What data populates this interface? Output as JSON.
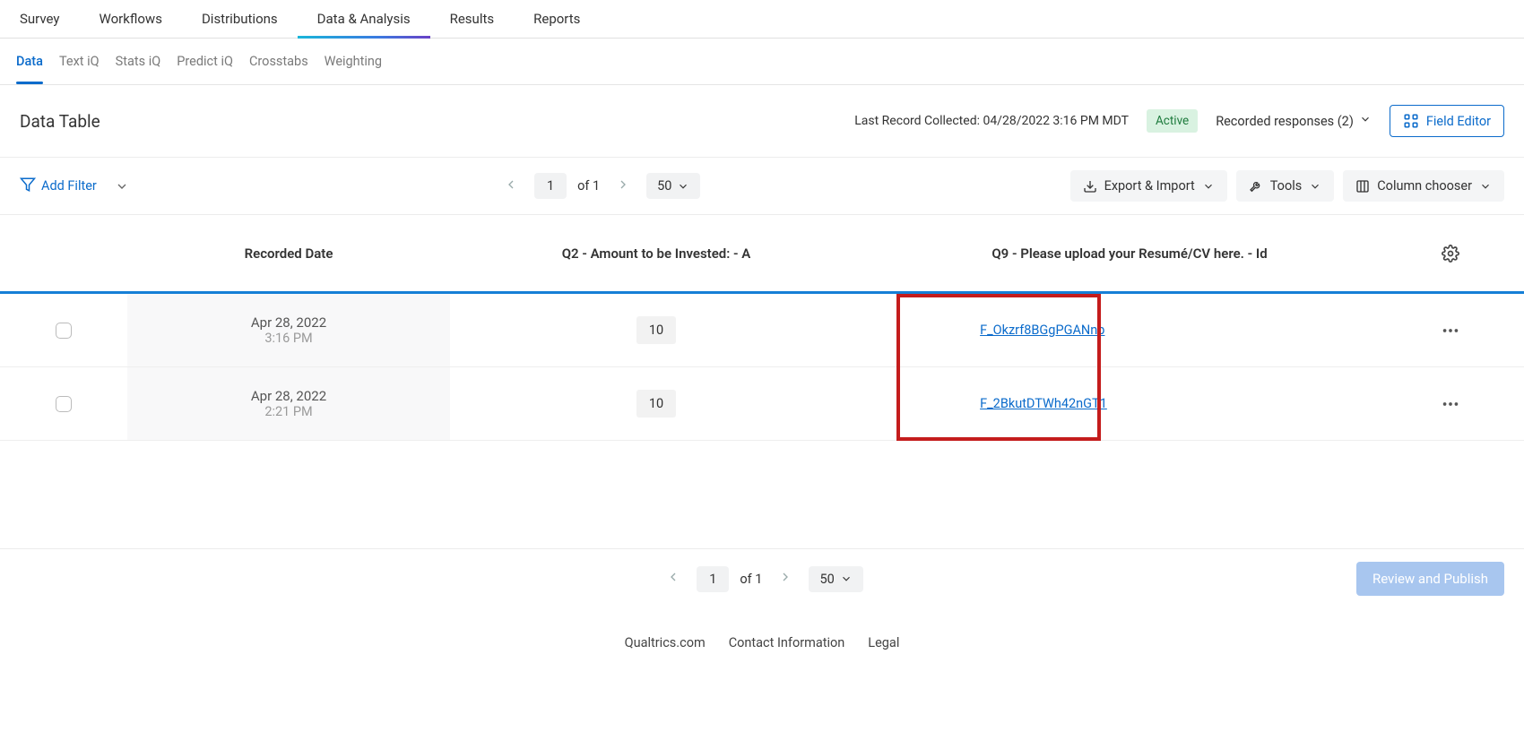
{
  "topnav": {
    "items": [
      "Survey",
      "Workflows",
      "Distributions",
      "Data & Analysis",
      "Results",
      "Reports"
    ],
    "activeIndex": 3
  },
  "subnav": {
    "items": [
      "Data",
      "Text iQ",
      "Stats iQ",
      "Predict iQ",
      "Crosstabs",
      "Weighting"
    ],
    "activeIndex": 0
  },
  "header": {
    "title": "Data Table",
    "lastRecord": "Last Record Collected: 04/28/2022 3:16 PM MDT",
    "status": "Active",
    "responses": "Recorded responses (2)",
    "fieldEditor": "Field Editor"
  },
  "toolbar": {
    "addFilter": "Add Filter",
    "page": "1",
    "ofPages": "of 1",
    "pageSize": "50",
    "exportImport": "Export & Import",
    "tools": "Tools",
    "columnChooser": "Column chooser"
  },
  "table": {
    "columns": {
      "recordedDate": "Recorded Date",
      "q2": "Q2 - Amount to be Invested: - A",
      "q9": "Q9 - Please upload your Resumé/CV here. - Id"
    },
    "rows": [
      {
        "date": "Apr 28, 2022",
        "time": "3:16 PM",
        "amount": "10",
        "fileId": "F_Okzrf8BGgPGANnb"
      },
      {
        "date": "Apr 28, 2022",
        "time": "2:21 PM",
        "amount": "10",
        "fileId": "F_2BkutDTWh42nGT1"
      }
    ]
  },
  "footer": {
    "page": "1",
    "ofPages": "of 1",
    "pageSize": "50",
    "reviewPublish": "Review and Publish",
    "links": [
      "Qualtrics.com",
      "Contact Information",
      "Legal"
    ]
  }
}
